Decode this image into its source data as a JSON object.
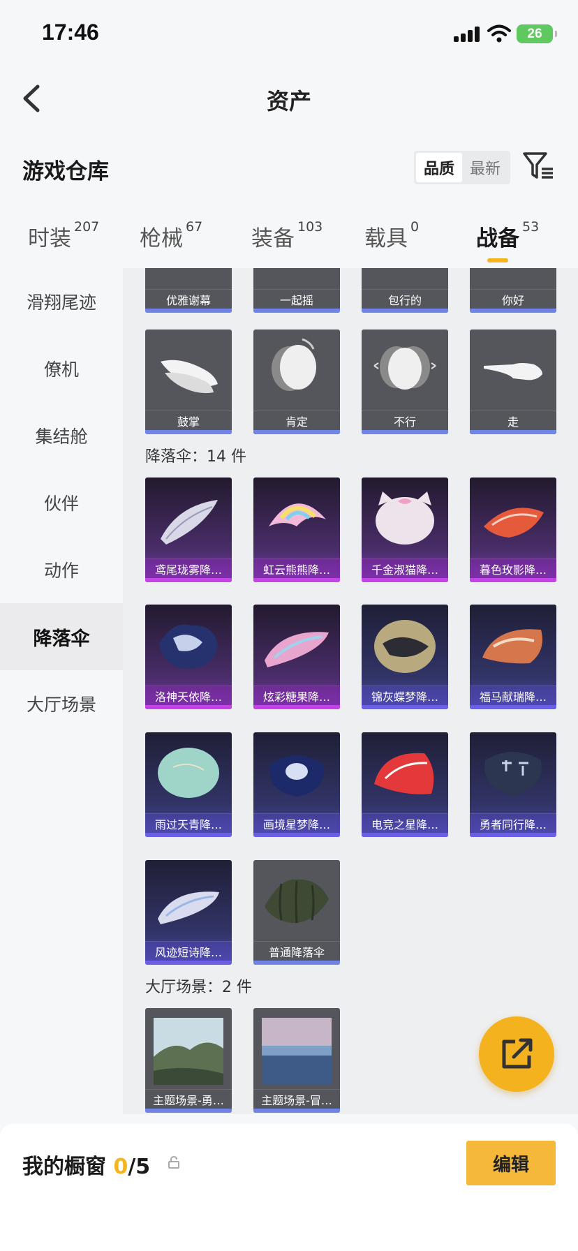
{
  "status_bar": {
    "time": "17:46",
    "battery": "26"
  },
  "nav": {
    "title": "资产"
  },
  "header": {
    "title": "游戏仓库",
    "sort_options": [
      "品质",
      "最新"
    ],
    "selected_sort": "品质"
  },
  "tabs": [
    {
      "label": "时装",
      "count": "207"
    },
    {
      "label": "枪械",
      "count": "67"
    },
    {
      "label": "装备",
      "count": "103"
    },
    {
      "label": "载具",
      "count": "0"
    },
    {
      "label": "战备",
      "count": "53"
    }
  ],
  "active_tab": "战备",
  "sidebar": {
    "items": [
      {
        "label": "滑翔尾迹"
      },
      {
        "label": "僚机"
      },
      {
        "label": "集结舱"
      },
      {
        "label": "伙伴"
      },
      {
        "label": "动作"
      },
      {
        "label": "降落伞"
      },
      {
        "label": "大厅场景"
      }
    ],
    "active": "降落伞"
  },
  "actions_top": [
    "优雅谢幕",
    "一起摇",
    "包行的",
    "你好"
  ],
  "actions": [
    "鼓掌",
    "肯定",
    "不行",
    "走"
  ],
  "parachute_group": {
    "title": "降落伞：14 件"
  },
  "parachutes": [
    {
      "name": "鸢尾珑雾降…",
      "tier": "purple"
    },
    {
      "name": "虹云熊熊降…",
      "tier": "purple"
    },
    {
      "name": "千金淑猫降…",
      "tier": "purple"
    },
    {
      "name": "暮色玫影降…",
      "tier": "purple"
    },
    {
      "name": "洛神天依降…",
      "tier": "purple"
    },
    {
      "name": "炫彩糖果降…",
      "tier": "purple"
    },
    {
      "name": "锦灰蝶梦降…",
      "tier": "blue"
    },
    {
      "name": "福马献瑞降…",
      "tier": "blue"
    },
    {
      "name": "雨过天青降…",
      "tier": "blue"
    },
    {
      "name": "画境星梦降…",
      "tier": "blue"
    },
    {
      "name": "电竞之星降…",
      "tier": "blue"
    },
    {
      "name": "勇者同行降…",
      "tier": "blue"
    },
    {
      "name": "风迹短诗降…",
      "tier": "blue"
    },
    {
      "name": "普通降落伞",
      "tier": "gray"
    }
  ],
  "lobby_group": {
    "title": "大厅场景：2 件"
  },
  "lobby_scenes": [
    {
      "name": "主题场景-勇…"
    },
    {
      "name": "主题场景-冒…"
    }
  ],
  "footer": {
    "label": "我的橱窗",
    "count": "0",
    "total": "/5",
    "edit_label": "编辑"
  },
  "colors": {
    "accent": "#f5b520",
    "purple_tier": "#c343e6",
    "blue_tier": "#6b5fe8"
  }
}
